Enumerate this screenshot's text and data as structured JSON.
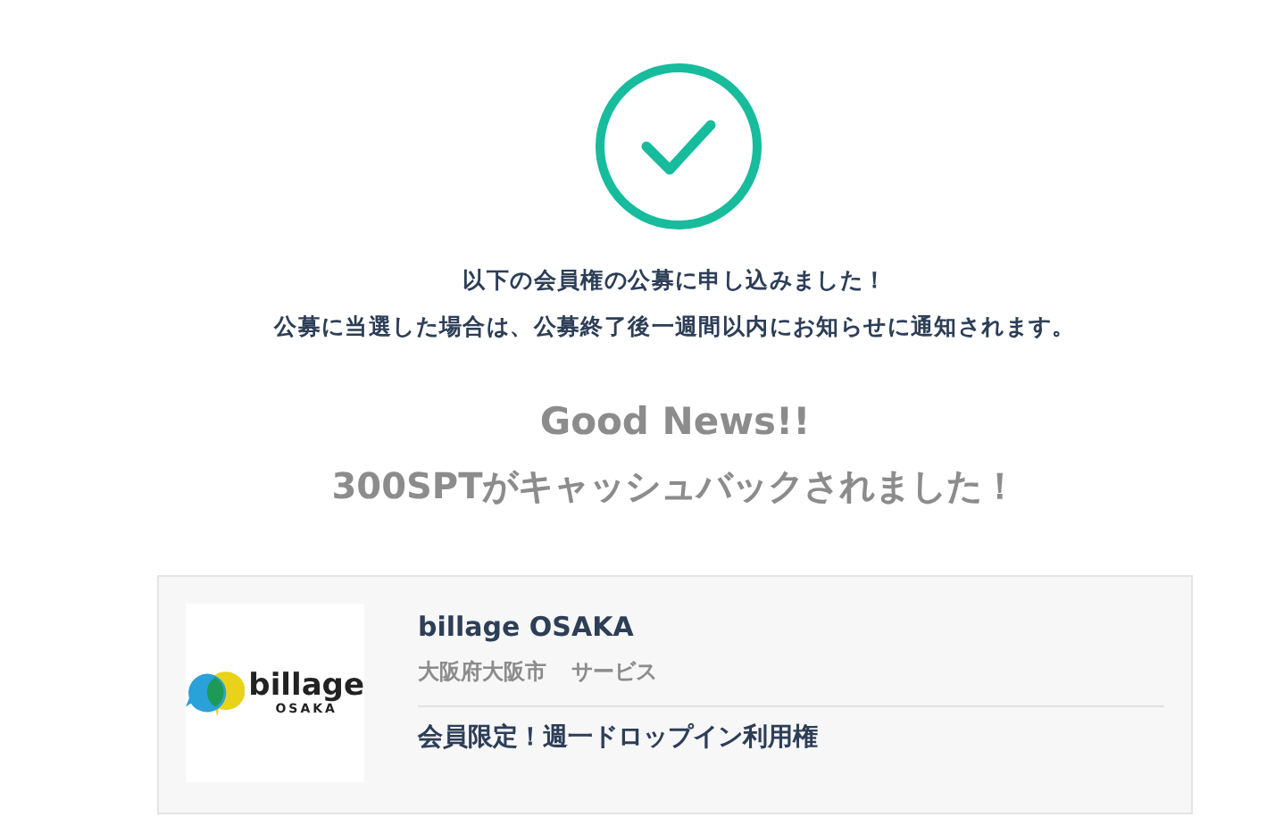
{
  "messages": [
    "以下の会員権の公募に申し込みました！",
    "公募に当選した場合は、公募終了後一週間以内にお知らせに通知されます。"
  ],
  "cashback": {
    "headline": "Good News!!",
    "text": "300SPTがキャッシュバックされました！"
  },
  "card": {
    "logo": {
      "word": "billage",
      "sub": "OSAKA"
    },
    "name": "billage OSAKA",
    "location": "大阪府大阪市",
    "category": "サービス",
    "plan": "会員限定！週一ドロップイン利用権"
  }
}
